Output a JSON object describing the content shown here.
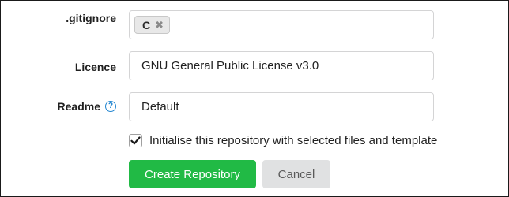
{
  "gitignore": {
    "label": ".gitignore",
    "chips": [
      {
        "text": "C",
        "remove_icon": "close-icon"
      }
    ]
  },
  "licence": {
    "label": "Licence",
    "value": "GNU General Public License v3.0"
  },
  "readme": {
    "label": "Readme",
    "help_icon": "question-circle-icon",
    "value": "Default"
  },
  "initialise": {
    "checked": true,
    "label": "Initialise this repository with selected files and template"
  },
  "buttons": {
    "create_label": "Create Repository",
    "cancel_label": "Cancel"
  },
  "colors": {
    "primary_green": "#21ba45",
    "secondary_grey": "#e0e1e2",
    "help_blue": "#2185d0"
  }
}
